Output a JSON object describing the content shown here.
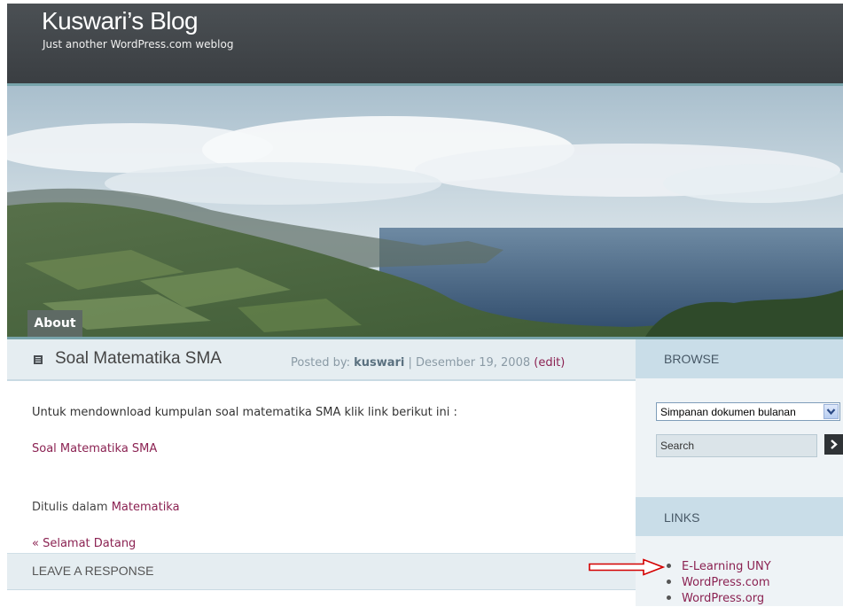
{
  "header": {
    "blog_title": "Kuswari’s Blog",
    "tagline": "Just another WordPress.com weblog"
  },
  "nav": {
    "about_label": "About"
  },
  "post": {
    "title": "Soal Matematika SMA",
    "meta_prefix": "Posted by: ",
    "author": "kuswari",
    "separator": " | ",
    "date": "Desember 19, 2008",
    "edit_label": "(edit)",
    "body_text": "Untuk mendownload kumpulan soal matematika SMA klik link berikut ini :",
    "body_link": "Soal Matematika SMA",
    "category_prefix": "Ditulis dalam ",
    "category": "Matematika",
    "previous_link": "« Selamat Datang"
  },
  "respond": {
    "title": "LEAVE A RESPONSE"
  },
  "sidebar": {
    "browse_title": "BROWSE",
    "archive_select_value": "Simpanan dokumen bulanan",
    "search_value": "Search",
    "search_button_icon": "arrow-right-icon",
    "links_title": "LINKS",
    "links": [
      {
        "label": "E-Learning UNY"
      },
      {
        "label": "WordPress.com"
      },
      {
        "label": "WordPress.org"
      }
    ]
  },
  "colors": {
    "header_bg": "#42474b",
    "accent_teal": "#78a4ab",
    "link": "#8b2252",
    "sidebar_head": "#c9dde8",
    "annotation_arrow": "#d40000"
  }
}
